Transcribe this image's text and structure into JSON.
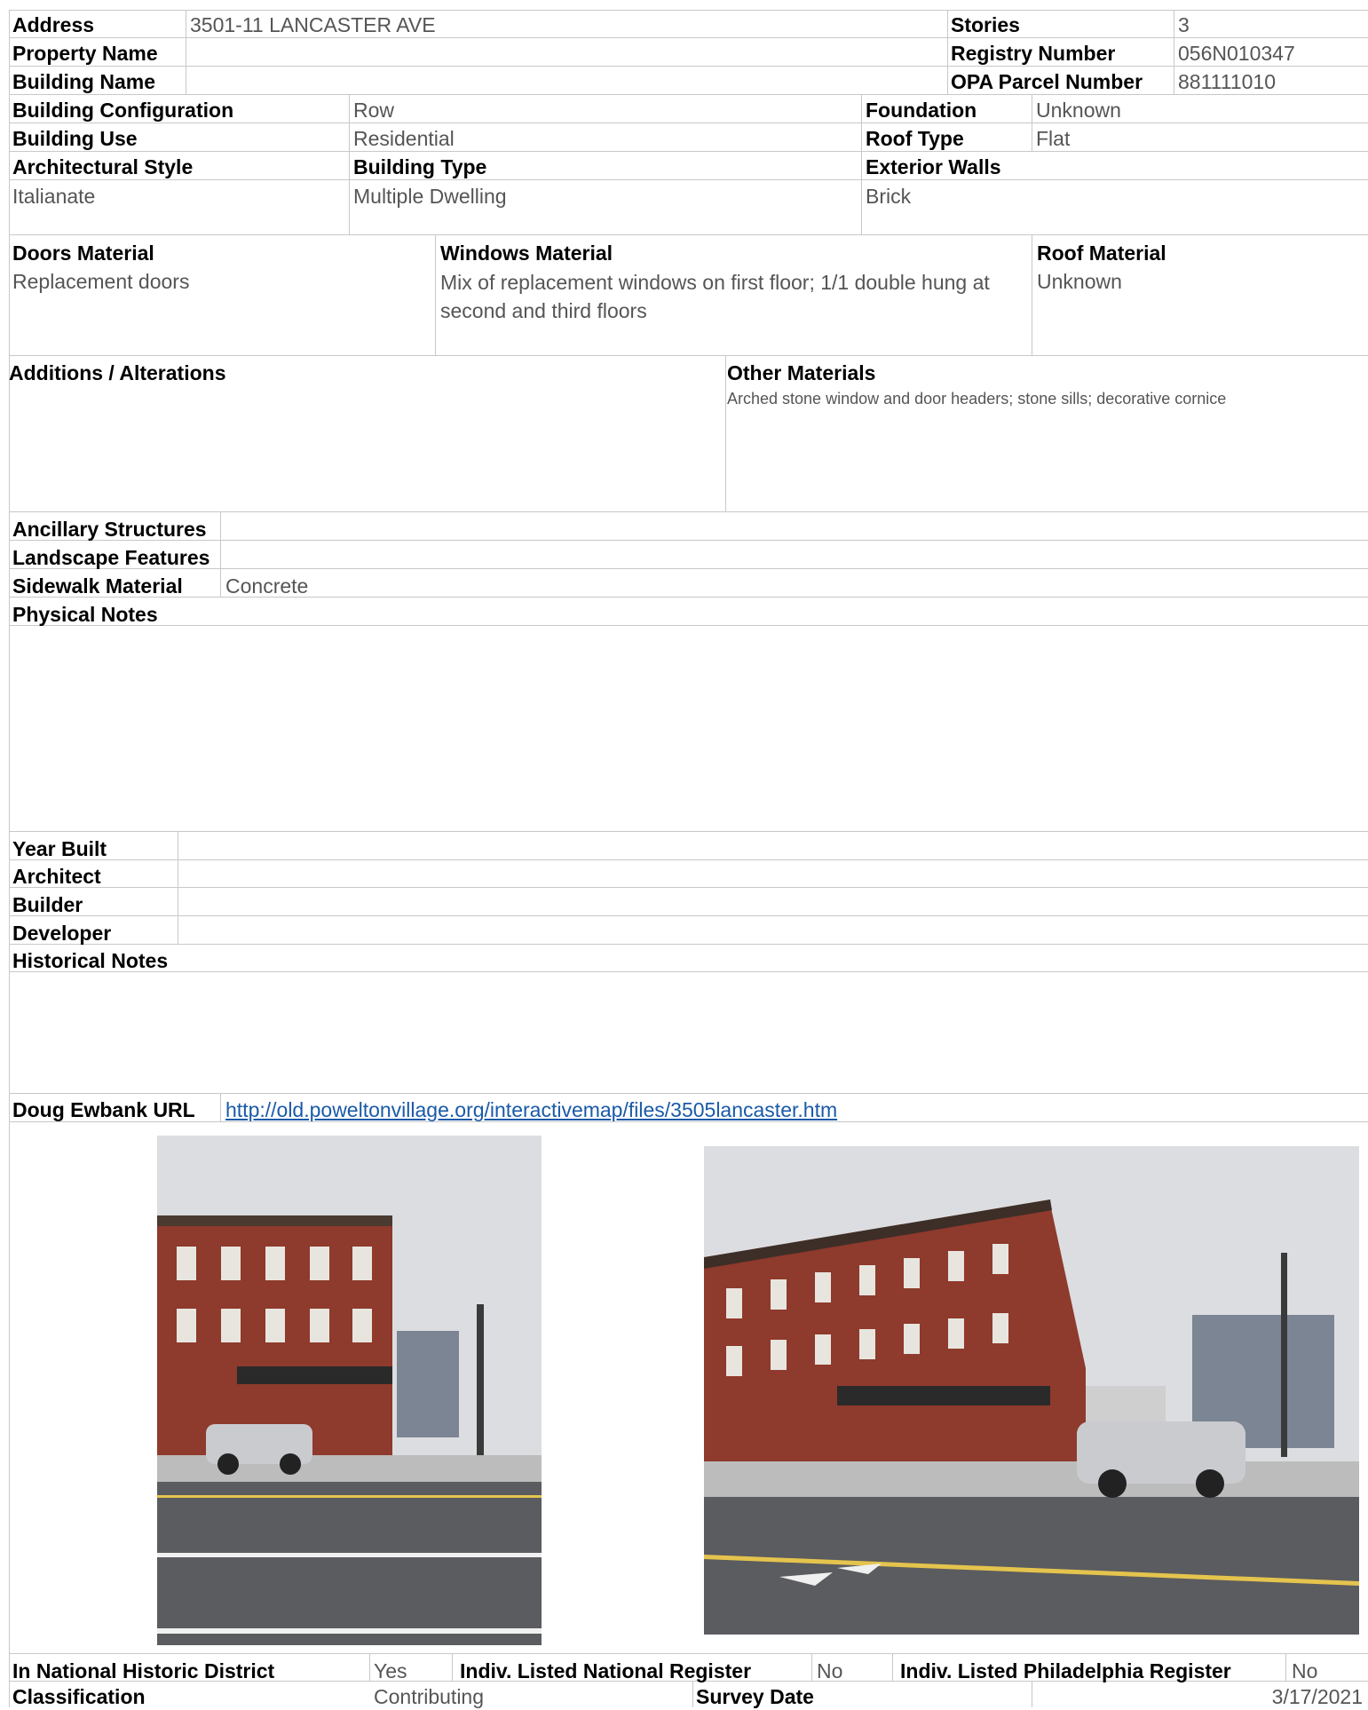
{
  "header": {
    "address_label": "Address",
    "address": "3501-11 LANCASTER AVE",
    "property_name_label": "Property Name",
    "property_name": "",
    "building_name_label": "Building Name",
    "building_name": "",
    "stories_label": "Stories",
    "stories": "3",
    "registry_label": "Registry Number",
    "registry": "056N010347",
    "opa_label": "OPA Parcel Number",
    "opa": "881111010"
  },
  "building": {
    "config_label": "Building Configuration",
    "config": "Row",
    "use_label": "Building Use",
    "use": "Residential",
    "foundation_label": "Foundation",
    "foundation": "Unknown",
    "roof_type_label": "Roof Type",
    "roof_type": "Flat",
    "style_label": "Architectural Style",
    "style": "Italianate",
    "type_label": "Building Type",
    "type": "Multiple Dwelling",
    "walls_label": "Exterior Walls",
    "walls": "Brick"
  },
  "materials": {
    "doors_label": "Doors Material",
    "doors": "Replacement doors",
    "windows_label": "Windows Material",
    "windows": "Mix of replacement windows on first floor; 1/1 double hung at second and third floors",
    "roof_label": "Roof Material",
    "roof": "Unknown",
    "additions_label": "Additions / Alterations",
    "additions": "",
    "other_label": "Other Materials",
    "other": "Arched stone window and door headers; stone sills; decorative cornice"
  },
  "site": {
    "ancillary_label": "Ancillary Structures",
    "ancillary": "",
    "landscape_label": "Landscape Features",
    "landscape": "",
    "sidewalk_label": "Sidewalk Material",
    "sidewalk": "Concrete",
    "physical_notes_label": "Physical Notes",
    "physical_notes": ""
  },
  "history": {
    "year_label": "Year Built",
    "year": "",
    "architect_label": "Architect",
    "architect": "",
    "builder_label": "Builder",
    "builder": "",
    "developer_label": "Developer",
    "developer": "",
    "notes_label": "Historical Notes",
    "notes": "",
    "url_label": "Doug Ewbank URL",
    "url": "http://old.poweltonvillage.org/interactivemap/files/3505lancaster.htm"
  },
  "photos": [
    {
      "name": "building-photo-front"
    },
    {
      "name": "building-photo-angle"
    }
  ],
  "footer": {
    "nhd_label": "In National Historic District",
    "nhd": "Yes",
    "nr_label": "Indiv. Listed National Register",
    "nr": "No",
    "pr_label": "Indiv. Listed Philadelphia Register",
    "pr": "No",
    "class_label": "Classification",
    "class": "Contributing",
    "survey_label": "Survey Date",
    "survey": "3/17/2021"
  },
  "colors": {
    "grid": "#c8c8c8",
    "value_text": "#555555",
    "link": "#1a5aa8",
    "brick": "#8e3a2c"
  }
}
